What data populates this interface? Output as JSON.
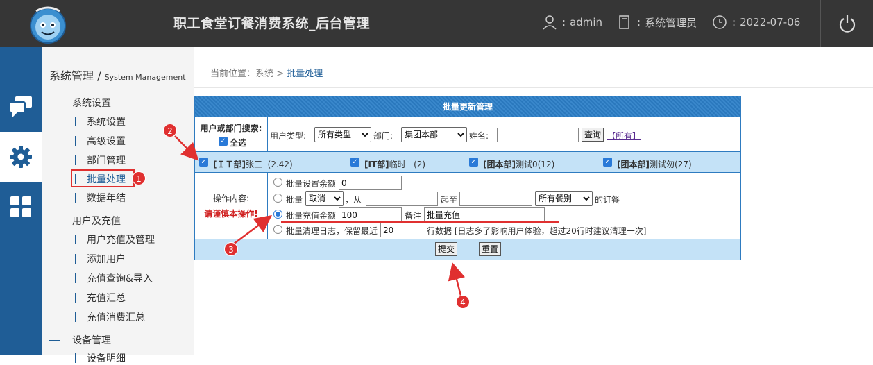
{
  "header": {
    "title": "职工食堂订餐消费系统_后台管理",
    "user_sep": ":",
    "user": "admin",
    "role_sep": ":",
    "role": "系统管理员",
    "date_sep": ":",
    "date": "2022-07-06"
  },
  "sidebar": {
    "title": "系统管理",
    "slash": "/",
    "subtitle": "System Management",
    "groups": [
      {
        "label": "系统设置",
        "items": [
          "系统设置",
          "高级设置",
          "部门管理",
          "批量处理",
          "数据年结"
        ]
      },
      {
        "label": "用户及充值",
        "items": [
          "用户充值及管理",
          "添加用户",
          "充值查询&导入",
          "充值汇总",
          "充值消费汇总"
        ]
      },
      {
        "label": "设备管理",
        "items": [
          "设备明细"
        ]
      }
    ],
    "active_item": "批量处理"
  },
  "breadcrumb": {
    "prefix": "当前位置：",
    "path": "系统",
    "sep": ">",
    "current": "批量处理"
  },
  "panel": {
    "title": "批量更新管理",
    "search": {
      "label": "用户或部门搜索:",
      "select_all": "全选",
      "user_type_label": "用户类型:",
      "user_type_value": "所有类型",
      "dept_label": "部门:",
      "dept_value": "集团本部",
      "name_label": "姓名:",
      "name_value": "",
      "query_button": "查询",
      "all_link": "【所有】"
    },
    "users": [
      {
        "dept": "[ＩＴ部]",
        "name": "张三",
        "balance": "(2.42)"
      },
      {
        "dept": "[IT部]",
        "name": "临时",
        "balance": "(2)"
      },
      {
        "dept": "[团本部]",
        "name": "测试0",
        "balance": "(12)"
      },
      {
        "dept": "[团本部]",
        "name": "测试勿",
        "balance": "(27)"
      }
    ],
    "ops": {
      "label": "操作内容:",
      "warning": "请谨慎本操作!",
      "opt1_label": "批量设置余额",
      "opt1_value": "0",
      "opt2_prefix": "批量",
      "opt2_select": "取消",
      "opt2_from": "，从",
      "opt2_from_value": "",
      "opt2_to": "起至",
      "opt2_to_value": "",
      "opt2_meal": "所有餐别",
      "opt2_suffix": "的订餐",
      "opt3_label": "批量充值金额",
      "opt3_value": "100",
      "opt3_note_label": "备注",
      "opt3_note_value": "批量充值",
      "opt4_label": "批量清理日志，保留最近",
      "opt4_value": "20",
      "opt4_suffix": "行数据 [日志多了影响用户体验，超过20行时建议清理一次]",
      "selected": 3
    },
    "submit_button": "提交",
    "reset_button": "重置"
  },
  "annotations": [
    "1",
    "2",
    "3",
    "4"
  ],
  "colors": {
    "accent": "#1f5d96",
    "topbar": "#363636",
    "panel_border": "#2e7bc0",
    "row_blue": "#c4e2f7",
    "annotation_red": "#e03030"
  }
}
